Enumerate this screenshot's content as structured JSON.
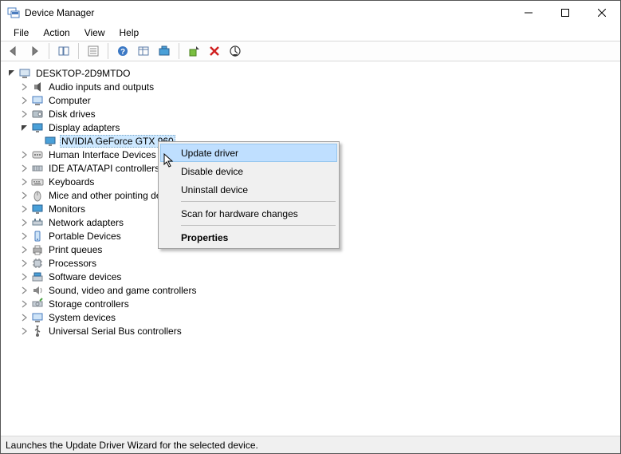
{
  "window": {
    "title": "Device Manager"
  },
  "menu": {
    "file": "File",
    "action": "Action",
    "view": "View",
    "help": "Help"
  },
  "root": {
    "name": "DESKTOP-2D9MTDO"
  },
  "devices": {
    "audio": "Audio inputs and outputs",
    "computer": "Computer",
    "disk": "Disk drives",
    "display": "Display adapters",
    "display_child": "NVIDIA GeForce GTX 960",
    "hid": "Human Interface Devices",
    "ide": "IDE ATA/ATAPI controllers",
    "keyboards": "Keyboards",
    "mice": "Mice and other pointing devices",
    "monitors": "Monitors",
    "network": "Network adapters",
    "portable": "Portable Devices",
    "print": "Print queues",
    "processors": "Processors",
    "software": "Software devices",
    "sound": "Sound, video and game controllers",
    "storage": "Storage controllers",
    "system": "System devices",
    "usb": "Universal Serial Bus controllers"
  },
  "context_menu": {
    "update": "Update driver",
    "disable": "Disable device",
    "uninstall": "Uninstall device",
    "scan": "Scan for hardware changes",
    "properties": "Properties"
  },
  "status": "Launches the Update Driver Wizard for the selected device."
}
